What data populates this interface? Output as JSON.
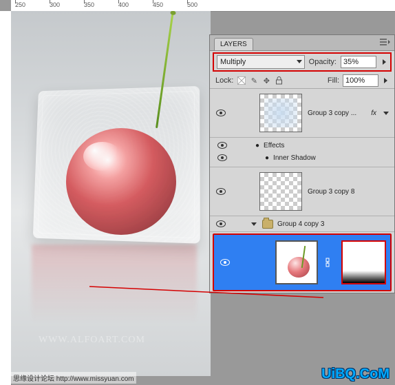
{
  "ruler_top": [
    "250",
    "300",
    "350",
    "400",
    "450",
    "500"
  ],
  "panel": {
    "tab": "LAYERS",
    "blend_mode": "Multiply",
    "opacity_label": "Opacity:",
    "opacity_value": "35%",
    "lock_label": "Lock:",
    "fill_label": "Fill:",
    "fill_value": "100%"
  },
  "layers": {
    "l1_name": "Group 3 copy ...",
    "l1_fx": "fx",
    "effects_label": "Effects",
    "effect1": "Inner Shadow",
    "l2_name": "Group 3 copy 8",
    "group_name": "Group 4 copy 3"
  },
  "canvas": {
    "url": "WWW.ALFOART.COM",
    "copyright": "思缘设计论坛   http://www.missyuan.com",
    "brand": "UiBQ.CoM"
  }
}
